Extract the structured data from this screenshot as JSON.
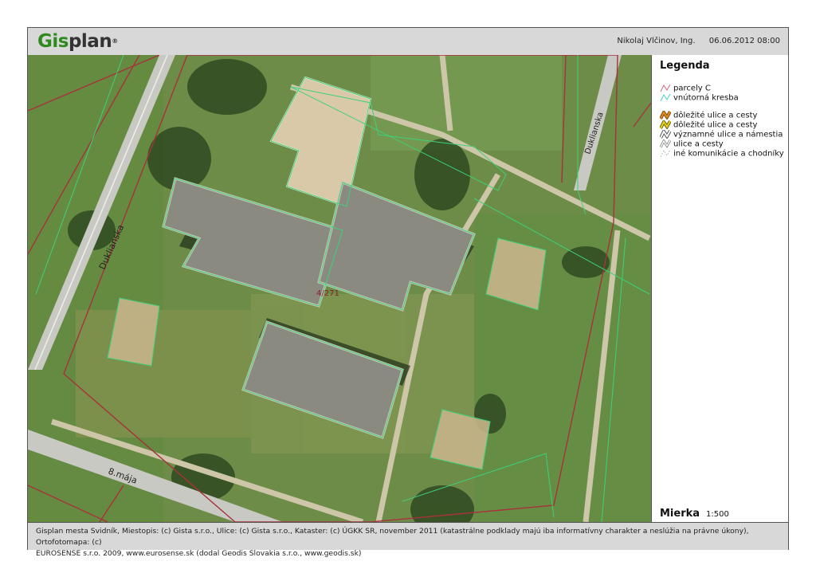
{
  "header": {
    "logo_part1": "Gis",
    "logo_part2": "plan",
    "logo_mark": "®",
    "user": "Nikolaj Vlčinov, Ing.",
    "datetime": "06.06.2012 08:00"
  },
  "map": {
    "street_labels": [
      "Duklianska",
      "Duklianska",
      "8.mája"
    ],
    "parcel_label": "4/271",
    "colors": {
      "parcel_line": "#a8323c",
      "inner_line": "#3fd07a",
      "grass": "#6d8c48",
      "roof_light": "#d9c9a8",
      "roof_grey": "#8a8a80"
    }
  },
  "legend": {
    "title": "Legenda",
    "items": [
      {
        "label": "parcely C",
        "icon": "pink-line-icon",
        "color": "#d06a80"
      },
      {
        "label": "vnútorná kresba",
        "icon": "cyan-line-icon",
        "color": "#4fd1c5"
      },
      {
        "label": "dôležité ulice a cesty",
        "icon": "orange-road-icon",
        "color": "#e58a1c"
      },
      {
        "label": "dôležité ulice a cesty",
        "icon": "yellow-road-icon",
        "color": "#e6d21a"
      },
      {
        "label": "významné ulice a námestia",
        "icon": "grey-road-icon",
        "color": "#888888"
      },
      {
        "label": "ulice a cesty",
        "icon": "grey-road-icon",
        "color": "#999999"
      },
      {
        "label": "iné komunikácie a chodníky",
        "icon": "dashed-path-icon",
        "color": "#bbbbbb"
      }
    ]
  },
  "scale": {
    "label": "Mierka",
    "value": "1:500"
  },
  "footer": {
    "line1": "Gisplan mesta Svidník, Miestopis: (c) Gista s.r.o., Ulice: (c) Gista s.r.o., Kataster: (c) ÚGKK SR, november 2011 (katastrálne podklady majú iba informatívny charakter a neslúžia na právne úkony), Ortofotomapa: (c)",
    "line2": "EUROSENSE s.r.o. 2009, www.eurosense.sk (dodal Geodis Slovakia s.r.o., www.geodis.sk)"
  }
}
